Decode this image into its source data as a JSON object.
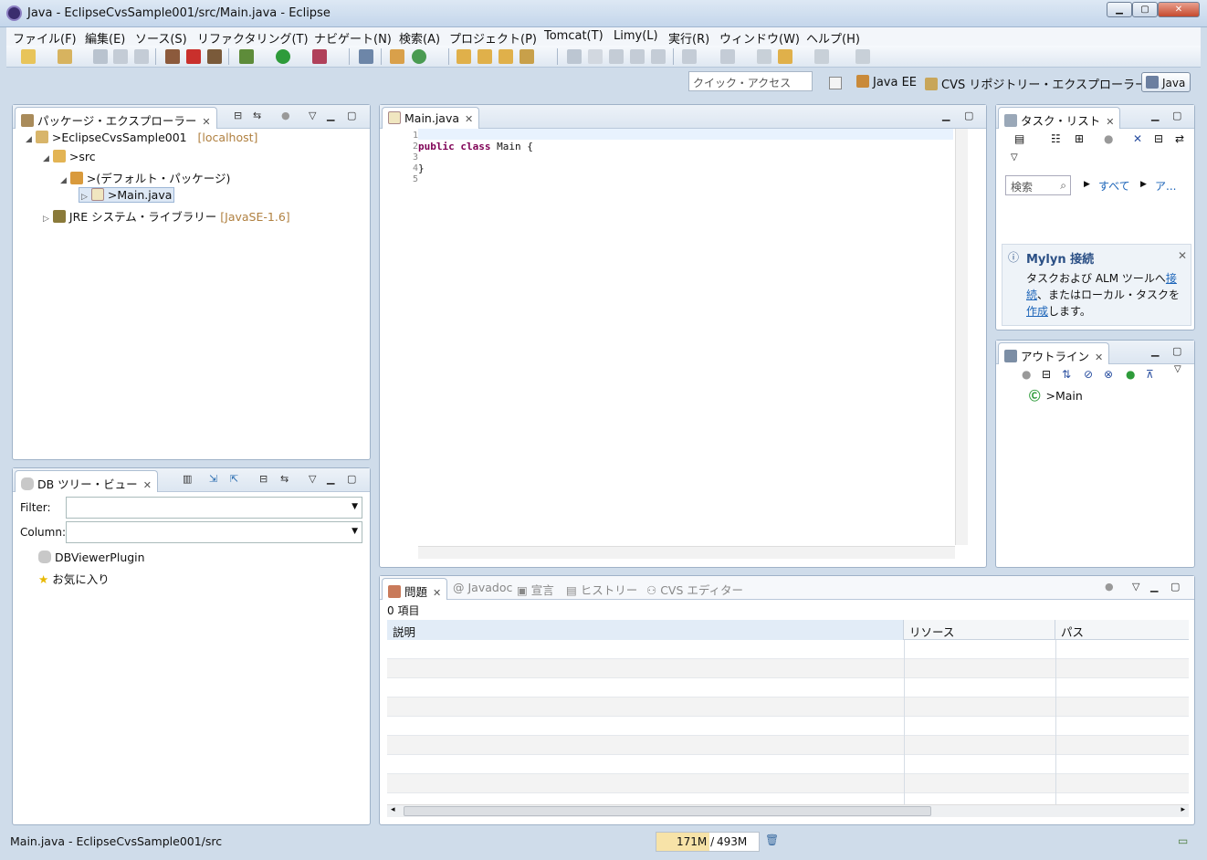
{
  "window": {
    "title": "Java - EclipseCvsSample001/src/Main.java - Eclipse",
    "min": "▁",
    "max": "▢",
    "close": "✕"
  },
  "menu": [
    "ファイル(F)",
    "編集(E)",
    "ソース(S)",
    "リファクタリング(T)",
    "ナビゲート(N)",
    "検索(A)",
    "プロジェクト(P)",
    "Tomcat(T)",
    "Limy(L)",
    "実行(R)",
    "ウィンドウ(W)",
    "ヘルプ(H)"
  ],
  "quick_access": {
    "placeholder": "クイック・アクセス"
  },
  "perspectives": [
    "Java EE",
    "CVS リポジトリー・エクスプローラー",
    "Java"
  ],
  "package_explorer": {
    "tab": "パッケージ・エクスプローラー",
    "project": ">EclipseCvsSample001",
    "project_suffix": "[localhost]",
    "src": ">src",
    "package": ">(デフォルト・パッケージ)",
    "file": ">Main.java",
    "jre": "JRE システム・ライブラリー",
    "jre_suffix": "[JavaSE-1.6]"
  },
  "db_tree": {
    "tab": "DB ツリー・ビュー",
    "filter_label": "Filter:",
    "column_label": "Column:",
    "items": [
      "DBViewerPlugin",
      "お気に入り"
    ]
  },
  "editor": {
    "tab": "Main.java",
    "line_numbers": [
      "1",
      "2",
      "3",
      "4",
      "5"
    ],
    "kw1": "public",
    "kw2": "class",
    "rest": " Main {",
    "line4": "}"
  },
  "task_list": {
    "tab": "タスク・リスト",
    "search": "検索",
    "all": "すべて",
    "more": "ア..."
  },
  "mylyn": {
    "title": "Mylyn 接続",
    "text_pre": "タスクおよび ALM ツールへ",
    "link1": "接続",
    "text_mid": "、またはローカル・タスクを",
    "link2": "作成",
    "text_post": "します。"
  },
  "outline": {
    "tab": "アウトライン",
    "item": ">Main"
  },
  "bottom": {
    "tabs": [
      "問題",
      "Javadoc",
      "宣言",
      "ヒストリー",
      "CVS エディター"
    ],
    "count": "0 項目",
    "columns": [
      "説明",
      "リソース",
      "パス"
    ]
  },
  "status": {
    "left": "Main.java - EclipseCvsSample001/src",
    "heap_used": "171M /",
    "heap_total": "493M"
  }
}
